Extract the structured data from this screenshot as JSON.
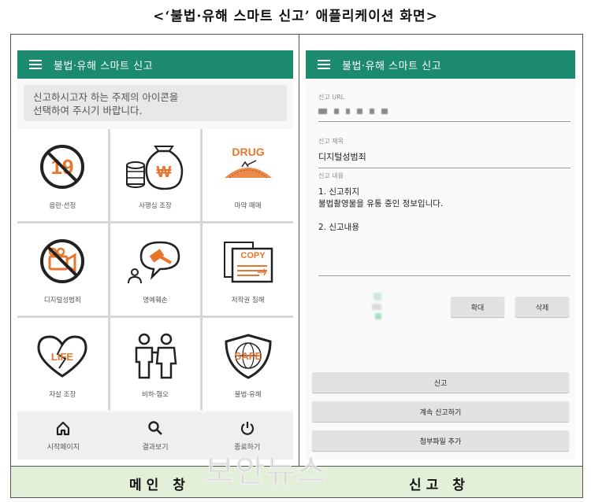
{
  "caption": "<‘불법·유해 스마트 신고’ 애플리케이션 화면>",
  "watermark": "보안뉴스",
  "footer": {
    "left": "메인 창",
    "right": "신고 창"
  },
  "colors": {
    "appbar": "#1c8a6f",
    "icon_orange": "#e6762e",
    "footer_bg": "#e2efd9"
  },
  "main": {
    "appbar_title": "불법·유해 스마트 신고",
    "menu_icon": "hamburger-icon",
    "notice": "신고하시고자 하는 주제의 아이콘을\n선택하여 주시기 바랍니다.",
    "tiles": [
      {
        "label": "음란·선정",
        "icon": "no-19-icon"
      },
      {
        "label": "사행심 조장",
        "icon": "money-bag-icon"
      },
      {
        "label": "마약 매매",
        "icon": "drug-icon"
      },
      {
        "label": "디지털성범죄",
        "icon": "no-camera-icon"
      },
      {
        "label": "명예훼손",
        "icon": "defamation-icon"
      },
      {
        "label": "저작권 침해",
        "icon": "copy-icon"
      },
      {
        "label": "자살 조장",
        "icon": "broken-heart-icon"
      },
      {
        "label": "비하·혐오",
        "icon": "people-icon"
      },
      {
        "label": "불법·유해",
        "icon": "safe-shield-icon"
      }
    ],
    "icon_texts": {
      "nineteen": "19",
      "drug": "DRUG",
      "copy": "COPY",
      "life": "LIFE",
      "safe": "SAFE",
      "won": "₩"
    },
    "nav": [
      {
        "label": "시작페이지",
        "icon": "home-icon"
      },
      {
        "label": "결과보기",
        "icon": "search-icon"
      },
      {
        "label": "종료하기",
        "icon": "power-icon"
      }
    ]
  },
  "report": {
    "appbar_title": "불법·유해 스마트 신고",
    "url_label": "신고 URL",
    "title_label": "신고 제목",
    "title_value": "디지털성범죄",
    "content_label": "신고 내용",
    "content_value": "1. 신고취지\n불법촬영물을 유통 중인 정보입니다.\n\n2. 신고내용",
    "zoom_button": "확대",
    "delete_button": "삭제",
    "report_button": "신고",
    "continue_button": "계속 신고하기",
    "attach_button": "첨부파일 추가"
  }
}
